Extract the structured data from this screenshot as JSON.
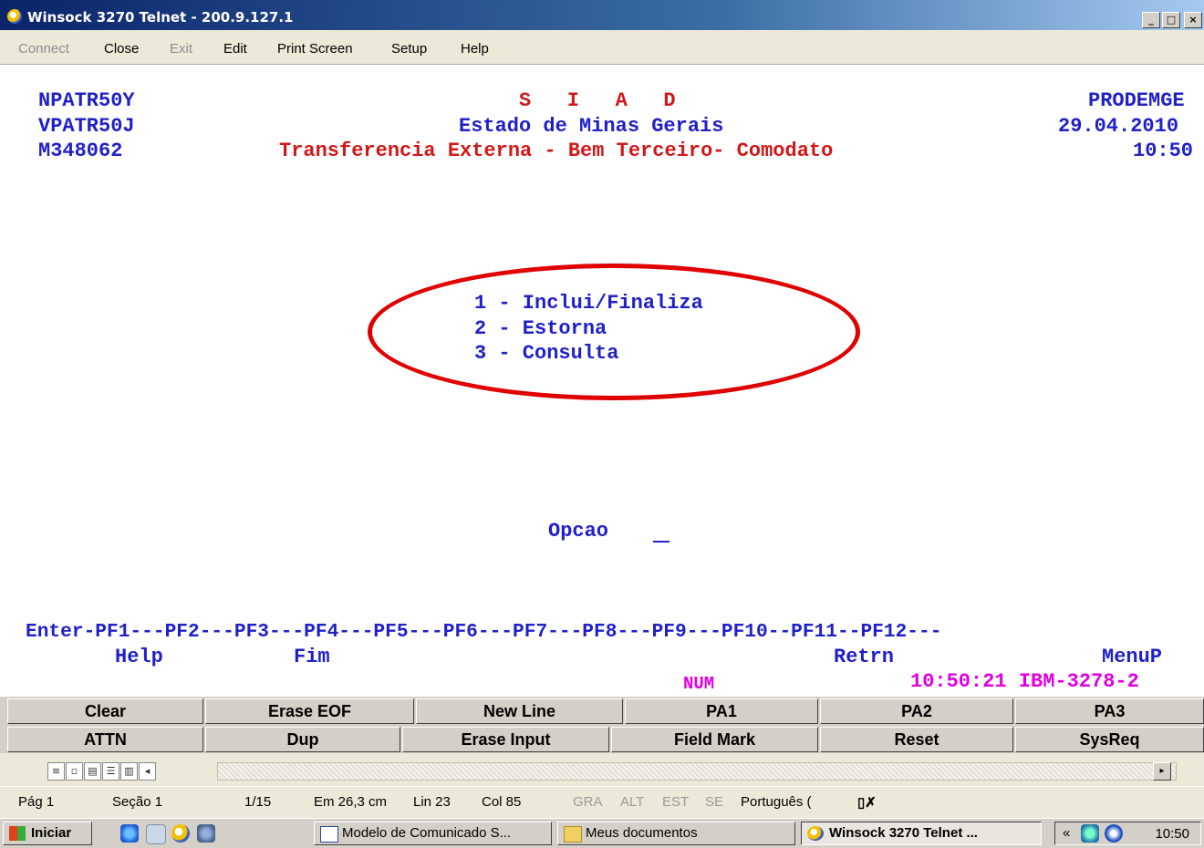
{
  "window": {
    "title": "Winsock 3270 Telnet - 200.9.127.1",
    "buttons": {
      "minimize": "_",
      "restore": "□",
      "close": "×"
    }
  },
  "menu": [
    {
      "label": "Connect",
      "enabled": false
    },
    {
      "label": "Close",
      "enabled": true
    },
    {
      "label": "Exit",
      "enabled": false
    },
    {
      "label": "Edit",
      "enabled": true
    },
    {
      "label": "Print Screen",
      "enabled": true
    },
    {
      "label": "Setup",
      "enabled": true
    },
    {
      "label": "Help",
      "enabled": true
    }
  ],
  "terminal": {
    "header_left": [
      "NPATR50Y",
      "VPATR50J",
      "M348062"
    ],
    "header_center": [
      "S   I   A   D",
      "Estado de Minas Gerais",
      "Transferencia Externa - Bem Terceiro- Comodato"
    ],
    "header_right": [
      "PRODEMGE",
      "29.04.2010",
      "10:50"
    ],
    "options": [
      "1 - Inclui/Finaliza",
      "2 - Estorna",
      "3 - Consulta"
    ],
    "prompt": "Opcao",
    "pf_line": "Enter-PF1---PF2---PF3---PF4---PF5---PF6---PF7---PF8---PF9---PF10--PF11--PF12---",
    "pf_labels": {
      "pf1": "Help",
      "pf3": "Fim",
      "pf9": "Retrn",
      "pf12": "MenuP"
    },
    "status": {
      "num": "NUM",
      "time_term": "10:50:21 IBM-3278-2"
    },
    "colors": {
      "blue": "#2020c8",
      "red": "#d01818",
      "pink": "#e000e0",
      "highlight": "#e00000"
    }
  },
  "keypad": {
    "row1": [
      "Clear",
      "Erase EOF",
      "New Line",
      "PA1",
      "PA2",
      "PA3"
    ],
    "row2": [
      "ATTN",
      "Dup",
      "Erase Input",
      "Field Mark",
      "Reset",
      "SysReq"
    ]
  },
  "statusbar": {
    "page": "Pág 1",
    "section": "Seção 1",
    "pages": "1/15",
    "position": "Em 26,3 cm",
    "line": "Lin 23",
    "col": "Col 85",
    "modes": [
      "GRA",
      "ALT",
      "EST",
      "SE"
    ],
    "language": "Português ("
  },
  "taskbar": {
    "start": "Iniciar",
    "tasks": [
      "Modelo de Comunicado S...",
      "Meus documentos",
      "Winsock 3270 Telnet ..."
    ],
    "tray_arrow": "«",
    "clock": "10:50"
  }
}
